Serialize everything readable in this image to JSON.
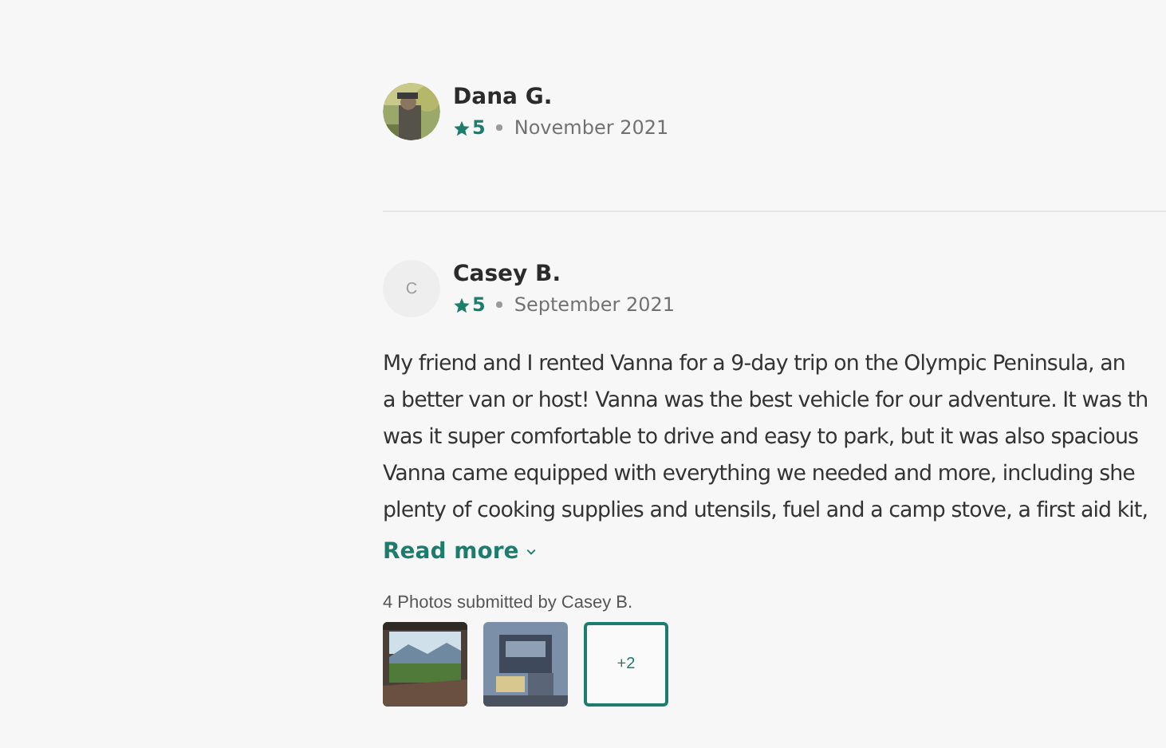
{
  "reviews": [
    {
      "name": "Dana G.",
      "avatar": {
        "kind": "picture"
      },
      "rating": "5",
      "date": "November 2021"
    },
    {
      "name": "Casey B.",
      "avatar": {
        "kind": "initial",
        "text": "C"
      },
      "rating": "5",
      "date": "September 2021",
      "body_lines": [
        "My friend and I rented Vanna for a 9-day trip on the Olympic Peninsula, an",
        "a better van or host! Vanna was the best vehicle for our adventure. It was th",
        "was it super comfortable to drive and easy to park, but it was also spacious",
        "Vanna came equipped with everything we needed and more, including she",
        "plenty of cooking supplies and utensils, fuel and a camp stove, a first aid kit,"
      ],
      "read_more": "Read more",
      "photos_caption": "4 Photos submitted by Casey B.",
      "photos": [
        {
          "kind": "picture"
        },
        {
          "kind": "picture"
        },
        {
          "kind": "more",
          "text": "+2"
        }
      ]
    }
  ]
}
